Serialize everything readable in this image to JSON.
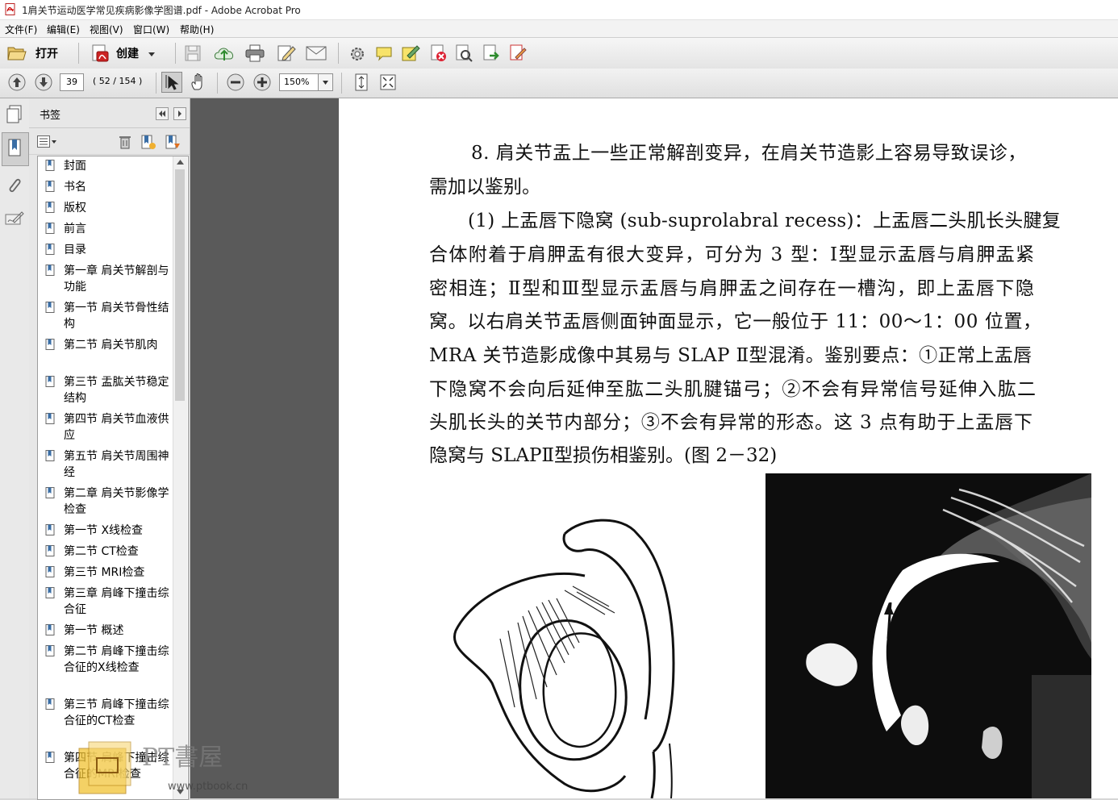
{
  "window": {
    "title": "1肩关节运动医学常见疾病影像学图谱.pdf - Adobe Acrobat Pro"
  },
  "menu": [
    "文件(F)",
    "编辑(E)",
    "视图(V)",
    "窗口(W)",
    "帮助(H)"
  ],
  "toolbar": {
    "open_label": "打开",
    "create_label": "创建"
  },
  "navigation": {
    "page_input": "39",
    "page_count": "( 52 / 154 )",
    "zoom": "150%"
  },
  "bookmarks": {
    "title": "书签",
    "items": [
      "封面",
      "书名",
      "版权",
      "前言",
      "目录",
      "第一章 肩关节解剖与功能",
      "第一节 肩关节骨性结构",
      "第二节 肩关节肌肉",
      "第三节 盂肱关节稳定结构",
      "第四节 肩关节血液供应",
      "第五节 肩关节周围神经",
      "第二章 肩关节影像学检查",
      "第一节 X线检查",
      "第二节 CT检查",
      "第三节 MRI检查",
      "第三章 肩峰下撞击综合征",
      "第一节 概述",
      "第二节 肩峰下撞击综合征的X线检查",
      "第三节 肩峰下撞击综合征的CT检查",
      "第四节 肩峰下撞击综合征的MRI检查"
    ]
  },
  "document": {
    "lines": [
      "8. 肩关节盂上一些正常解剖变异，在肩关节造影上容易导致误诊，",
      "需加以鉴别。",
      "(1) 上盂唇下隐窝 (sub-suprolabral recess)：上盂唇二头肌长头腱复",
      "合体附着于肩胛盂有很大变异，可分为 3 型：Ⅰ型显示盂唇与肩胛盂紧",
      "密相连；Ⅱ型和Ⅲ型显示盂唇与肩胛盂之间存在一槽沟，即上盂唇下隐",
      "窝。以右肩关节盂唇侧面钟面显示，它一般位于 11：00～1：00 位置，",
      "MRA 关节造影成像中其易与 SLAP Ⅱ型混淆。鉴别要点：①正常上盂唇",
      "下隐窝不会向后延伸至肱二头肌腱锚弓；②不会有异常信号延伸入肱二",
      "头肌长头的关节内部分；③不会有异常的形态。这 3 点有助于上盂唇下",
      "隐窝与 SLAPⅡ型损伤相鉴别。(图 2－32)"
    ]
  },
  "watermark": {
    "text": "PT書屋",
    "url": "www.ptbook.cn"
  },
  "colors": {
    "page_bg": "#ffffff",
    "gray_area": "#5a5a5a",
    "bookmark_icon": "#3a6ea5"
  }
}
